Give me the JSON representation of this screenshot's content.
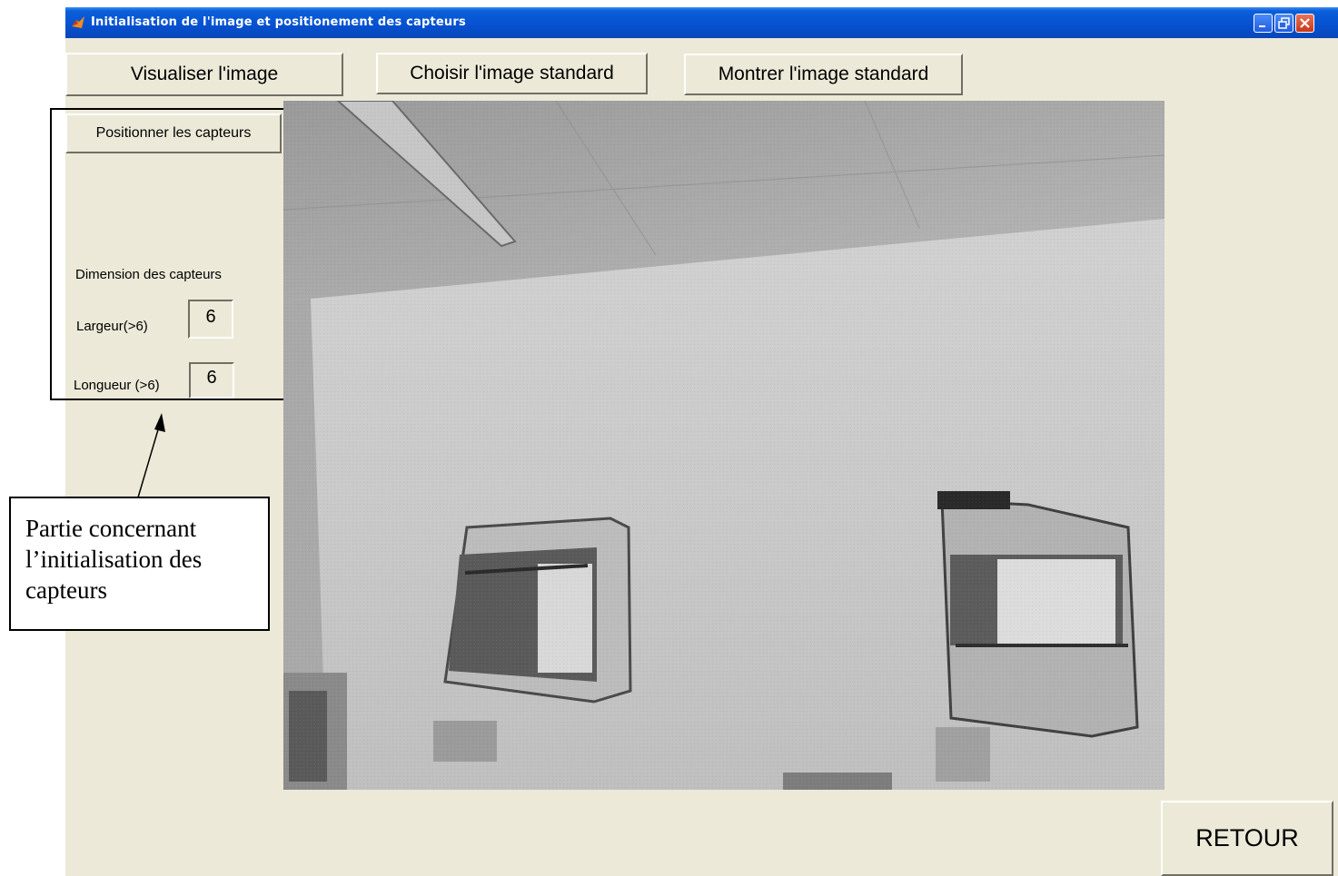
{
  "window": {
    "title": "Initialisation de l'image et positionement des capteurs"
  },
  "toolbar": {
    "visualiser_label": "Visualiser l'image",
    "choisir_label": "Choisir l'image standard",
    "montrer_label": "Montrer l'image standard"
  },
  "sensor_panel": {
    "position_button_label": "Positionner les capteurs",
    "dimension_heading": "Dimension des capteurs",
    "largeur_label": "Largeur(>6)",
    "largeur_value": "6",
    "longueur_label": "Longueur (>6)",
    "longueur_value": "6"
  },
  "retour_label": "RETOUR",
  "annotation": {
    "text": "Partie concernant l’initialisation des capteurs"
  },
  "colors": {
    "window_bg": "#ece9d8",
    "titlebar": "#0a5fd8"
  },
  "icons": {
    "app": "matlab-icon",
    "minimize": "minimize-icon",
    "maximize": "restore-icon",
    "close": "close-icon"
  }
}
